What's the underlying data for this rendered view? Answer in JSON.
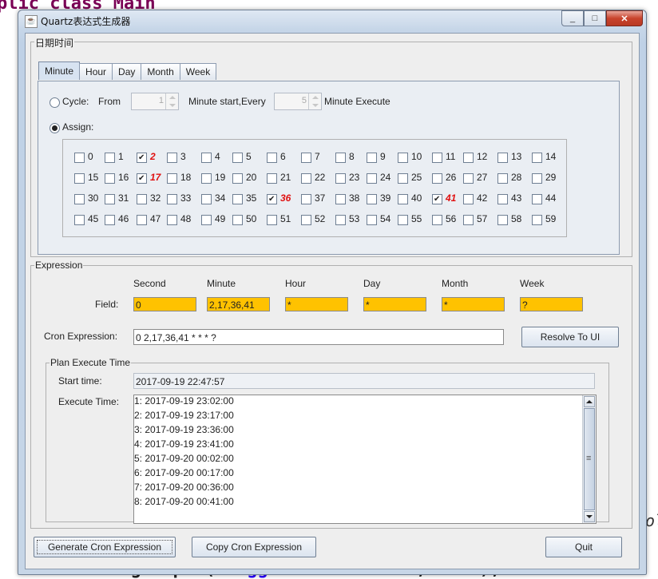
{
  "background": {
    "code_top": "plic class Main",
    "code_bottom_prefix": "UIManager.put(",
    "code_bottom_string": "\"ToggleButton.font\"",
    "code_bottom_suffix": ", font);",
    "code_right": "ol"
  },
  "window": {
    "title": "Quartz表达式生成器",
    "minimize": "_",
    "maximize": "□",
    "close": "✕"
  },
  "datetime": {
    "legend": "日期时间",
    "tabs": [
      "Minute",
      "Hour",
      "Day",
      "Month",
      "Week"
    ],
    "cycle": {
      "label": "Cycle:",
      "from_label": "From",
      "from_value": "1",
      "start_label": "Minute start,Every",
      "every_value": "5",
      "execute_label": "Minute Execute"
    },
    "assign_label": "Assign:",
    "minutes": [
      "0",
      "1",
      "2",
      "3",
      "4",
      "5",
      "6",
      "7",
      "8",
      "9",
      "10",
      "11",
      "12",
      "13",
      "14",
      "15",
      "16",
      "17",
      "18",
      "19",
      "20",
      "21",
      "22",
      "23",
      "24",
      "25",
      "26",
      "27",
      "28",
      "29",
      "30",
      "31",
      "32",
      "33",
      "34",
      "35",
      "36",
      "37",
      "38",
      "39",
      "40",
      "41",
      "42",
      "43",
      "44",
      "45",
      "46",
      "47",
      "48",
      "49",
      "50",
      "51",
      "52",
      "53",
      "54",
      "55",
      "56",
      "57",
      "58",
      "59"
    ],
    "checked_minutes": [
      "2",
      "17",
      "36",
      "41"
    ]
  },
  "expression": {
    "legend": "Expression",
    "field_label": "Field:",
    "columns": [
      {
        "header": "Second",
        "value": "0"
      },
      {
        "header": "Minute",
        "value": "2,17,36,41"
      },
      {
        "header": "Hour",
        "value": "*"
      },
      {
        "header": "Day",
        "value": "*"
      },
      {
        "header": "Month",
        "value": "*"
      },
      {
        "header": "Week",
        "value": "?"
      }
    ],
    "cron_label": "Cron Expression:",
    "cron_value": "0 2,17,36,41 * * * ?",
    "resolve_button": "Resolve To UI"
  },
  "plan": {
    "legend": "Plan Execute Time",
    "start_label": "Start time:",
    "start_value": "2017-09-19 22:47:57",
    "execute_label": "Execute Time:",
    "times": [
      "1: 2017-09-19 23:02:00",
      "2: 2017-09-19 23:17:00",
      "3: 2017-09-19 23:36:00",
      "4: 2017-09-19 23:41:00",
      "5: 2017-09-20 00:02:00",
      "6: 2017-09-20 00:17:00",
      "7: 2017-09-20 00:36:00",
      "8: 2017-09-20 00:41:00"
    ]
  },
  "footer": {
    "generate_button": "Generate Cron Expression",
    "copy_button": "Copy Cron Expression",
    "quit_button": "Quit"
  },
  "colors": {
    "field_bg": "#ffc200",
    "checked_label": "#e01010"
  }
}
